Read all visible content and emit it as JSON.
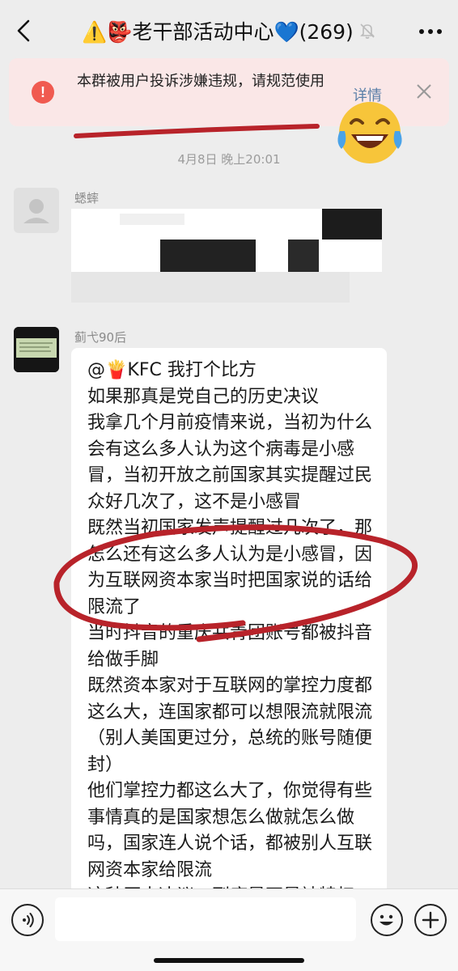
{
  "header": {
    "title": "⚠️👺老干部活动中心💙(269)",
    "back_icon": "chevron-left-icon",
    "mute_icon": "bell-muted-icon",
    "more_icon": "more-dots-icon"
  },
  "warning": {
    "icon": "exclamation-icon",
    "text": "本群被用户投诉涉嫌违规，请规范使用",
    "detail_label": "详情",
    "close_icon": "close-icon",
    "accent": "#f05a50",
    "background": "#fae7e7"
  },
  "annotation": {
    "emoji": "😂",
    "color": "#b8232a"
  },
  "timestamp": "4月8日 晚上20:01",
  "messages": [
    {
      "sender": "蟋蟀",
      "avatar": "default-avatar-icon",
      "content_blurred": true
    },
    {
      "sender": "蓟弋90后",
      "avatar": "photo-avatar",
      "text": "@🍟KFC        我打个比方\n如果那真是党自己的历史决议\n我拿几个月前疫情来说，当初为什么会有这么多人认为这个病毒是小感冒，当初开放之前国家其实提醒过民众好几次了，这不是小感冒\n既然当初国家发声提醒过几次了，那怎么还有这么多人认为是小感冒，因为互联网资本家当时把国家说的话给限流了\n当时抖音的重庆共青团账号都被抖音给做手脚\n既然资本家对于互联网的掌控力度都这么大，连国家都可以想限流就限流（别人美国更过分，总统的账号随便封）\n他们掌控力都这么大了，你觉得有些事情真的是国家想怎么做就怎么做吗，国家连人说个话，都被别人互联网资本家给限流\n这种历史决议，到底是不是被特权"
    }
  ],
  "input_bar": {
    "voice_icon": "voice-icon",
    "emoji_icon": "smiley-icon",
    "plus_icon": "plus-icon",
    "input_value": "",
    "input_placeholder": ""
  }
}
